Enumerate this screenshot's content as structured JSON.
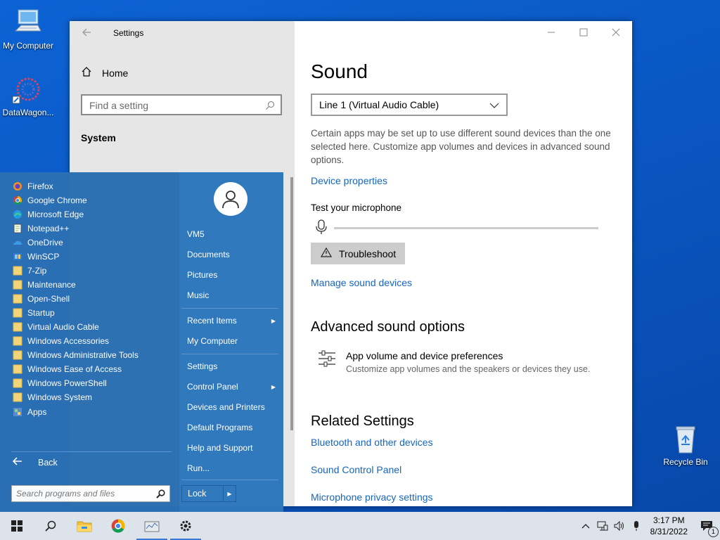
{
  "desktop": {
    "icons": [
      {
        "label": "My Computer"
      },
      {
        "label": "DataWagon..."
      },
      {
        "label": "Recycle Bin"
      }
    ]
  },
  "settings": {
    "window_title": "Settings",
    "home_label": "Home",
    "search_placeholder": "Find a setting",
    "section_label": "System",
    "page_title": "Sound",
    "device_dropdown_value": "Line 1 (Virtual Audio Cable)",
    "description": "Certain apps may be set up to use different sound devices than the one selected here. Customize app volumes and devices in advanced sound options.",
    "device_properties_link": "Device properties",
    "test_mic_label": "Test your microphone",
    "mic_level": 0,
    "troubleshoot_label": "Troubleshoot",
    "manage_devices_link": "Manage sound devices",
    "advanced_heading": "Advanced sound options",
    "app_volume_title": "App volume and device preferences",
    "app_volume_desc": "Customize app volumes and the speakers or devices they use.",
    "related_heading": "Related Settings",
    "related_links": [
      {
        "label": "Bluetooth and other devices"
      },
      {
        "label": "Sound Control Panel"
      },
      {
        "label": "Microphone privacy settings"
      }
    ]
  },
  "start_menu": {
    "programs": [
      {
        "label": "Firefox",
        "icon": "firefox-icon"
      },
      {
        "label": "Google Chrome",
        "icon": "chrome-icon"
      },
      {
        "label": "Microsoft Edge",
        "icon": "edge-icon"
      },
      {
        "label": "Notepad++",
        "icon": "notepad-plus-plus-icon"
      },
      {
        "label": "OneDrive",
        "icon": "onedrive-icon"
      },
      {
        "label": "WinSCP",
        "icon": "winscp-icon"
      },
      {
        "label": "7-Zip",
        "icon": "folder-icon"
      },
      {
        "label": "Maintenance",
        "icon": "folder-icon"
      },
      {
        "label": "Open-Shell",
        "icon": "folder-icon"
      },
      {
        "label": "Startup",
        "icon": "folder-icon"
      },
      {
        "label": "Virtual Audio Cable",
        "icon": "folder-icon"
      },
      {
        "label": "Windows Accessories",
        "icon": "folder-icon"
      },
      {
        "label": "Windows Administrative Tools",
        "icon": "folder-icon"
      },
      {
        "label": "Windows Ease of Access",
        "icon": "folder-icon"
      },
      {
        "label": "Windows PowerShell",
        "icon": "folder-icon"
      },
      {
        "label": "Windows System",
        "icon": "folder-icon"
      },
      {
        "label": "Apps",
        "icon": "apps-icon"
      }
    ],
    "back_label": "Back",
    "search_placeholder": "Search programs and files",
    "right_items": [
      {
        "label": "VM5",
        "has_submenu": false
      },
      {
        "label": "Documents",
        "has_submenu": false
      },
      {
        "label": "Pictures",
        "has_submenu": false
      },
      {
        "label": "Music",
        "has_submenu": false
      },
      {
        "label": "Recent Items",
        "has_submenu": true
      },
      {
        "label": "My Computer",
        "has_submenu": false
      },
      {
        "label": "Settings",
        "has_submenu": false
      },
      {
        "label": "Control Panel",
        "has_submenu": true
      },
      {
        "label": "Devices and Printers",
        "has_submenu": false
      },
      {
        "label": "Default Programs",
        "has_submenu": false
      },
      {
        "label": "Help and Support",
        "has_submenu": false
      },
      {
        "label": "Run...",
        "has_submenu": false
      }
    ],
    "lock_label": "Lock"
  },
  "taskbar": {
    "apps": [
      {
        "name": "start-button",
        "icon": "windows-logo-icon"
      },
      {
        "name": "search-button",
        "icon": "search-icon"
      },
      {
        "name": "file-explorer-button",
        "icon": "folder-icon"
      },
      {
        "name": "chrome-taskbar-button",
        "icon": "chrome-icon"
      },
      {
        "name": "datawagon-taskbar-button",
        "icon": "datawagon-icon"
      },
      {
        "name": "settings-taskbar-button",
        "icon": "gear-icon"
      }
    ],
    "time": "3:17 PM",
    "date": "8/31/2022",
    "notification_count": "1"
  },
  "colors": {
    "accent": "#1565c0",
    "desktop": "#0a56c2",
    "start_menu": "#2b6fb3",
    "taskbar": "#dde3ea"
  }
}
